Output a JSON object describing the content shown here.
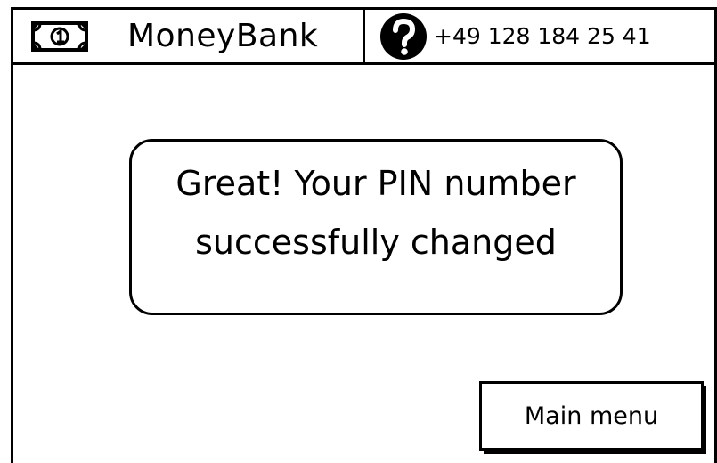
{
  "header": {
    "brand_name": "MoneyBank",
    "logo_icon": "banknote-icon",
    "help_icon": "question-circle-icon",
    "phone": "+49 128 184 25 41"
  },
  "message": {
    "line1": "Great! Your PIN number",
    "line2": "successfully changed"
  },
  "actions": {
    "main_menu_label": "Main menu"
  },
  "colors": {
    "ink": "#000000",
    "background": "#ffffff"
  }
}
